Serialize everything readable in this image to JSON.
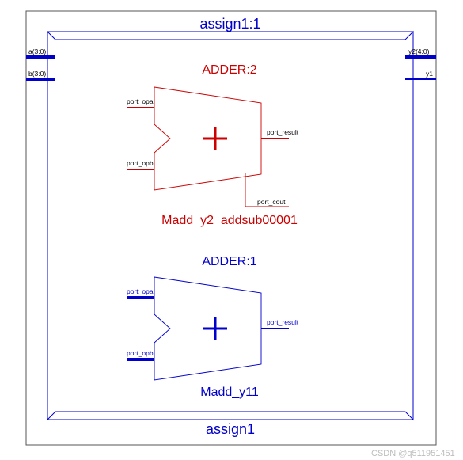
{
  "module": {
    "title": "assign1:1",
    "instance": "assign1",
    "inputs": [
      {
        "label": "a(3:0)"
      },
      {
        "label": "b(3:0)"
      }
    ],
    "outputs": [
      {
        "label": "y2(4:0)"
      },
      {
        "label": "y1"
      }
    ]
  },
  "adder2": {
    "title": "ADDER:2",
    "instance": "Madd_y2_addsub00001",
    "port_opa": "port_opa",
    "port_opb": "port_opb",
    "port_result": "port_result",
    "port_cout": "port_cout"
  },
  "adder1": {
    "title": "ADDER:1",
    "instance": "Madd_y11",
    "port_opa": "port_opa",
    "port_opb": "port_opb",
    "port_result": "port_result"
  },
  "watermark": "CSDN @q511951451"
}
